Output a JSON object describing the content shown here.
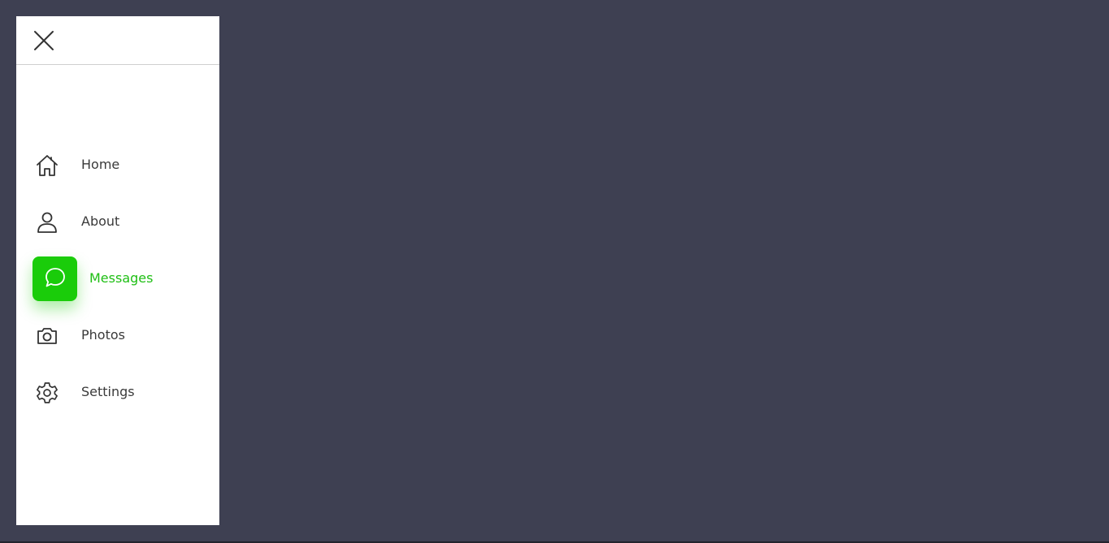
{
  "sidebar": {
    "close_icon": "close-icon",
    "items": [
      {
        "label": "Home",
        "icon": "home-icon",
        "active": false
      },
      {
        "label": "About",
        "icon": "user-icon",
        "active": false
      },
      {
        "label": "Messages",
        "icon": "message-bubble-icon",
        "active": true
      },
      {
        "label": "Photos",
        "icon": "camera-icon",
        "active": false
      },
      {
        "label": "Settings",
        "icon": "gear-icon",
        "active": false
      }
    ]
  },
  "colors": {
    "background": "#3e4052",
    "sidebar": "#ffffff",
    "accent": "#1acc0a",
    "text": "#3a3a3a"
  }
}
